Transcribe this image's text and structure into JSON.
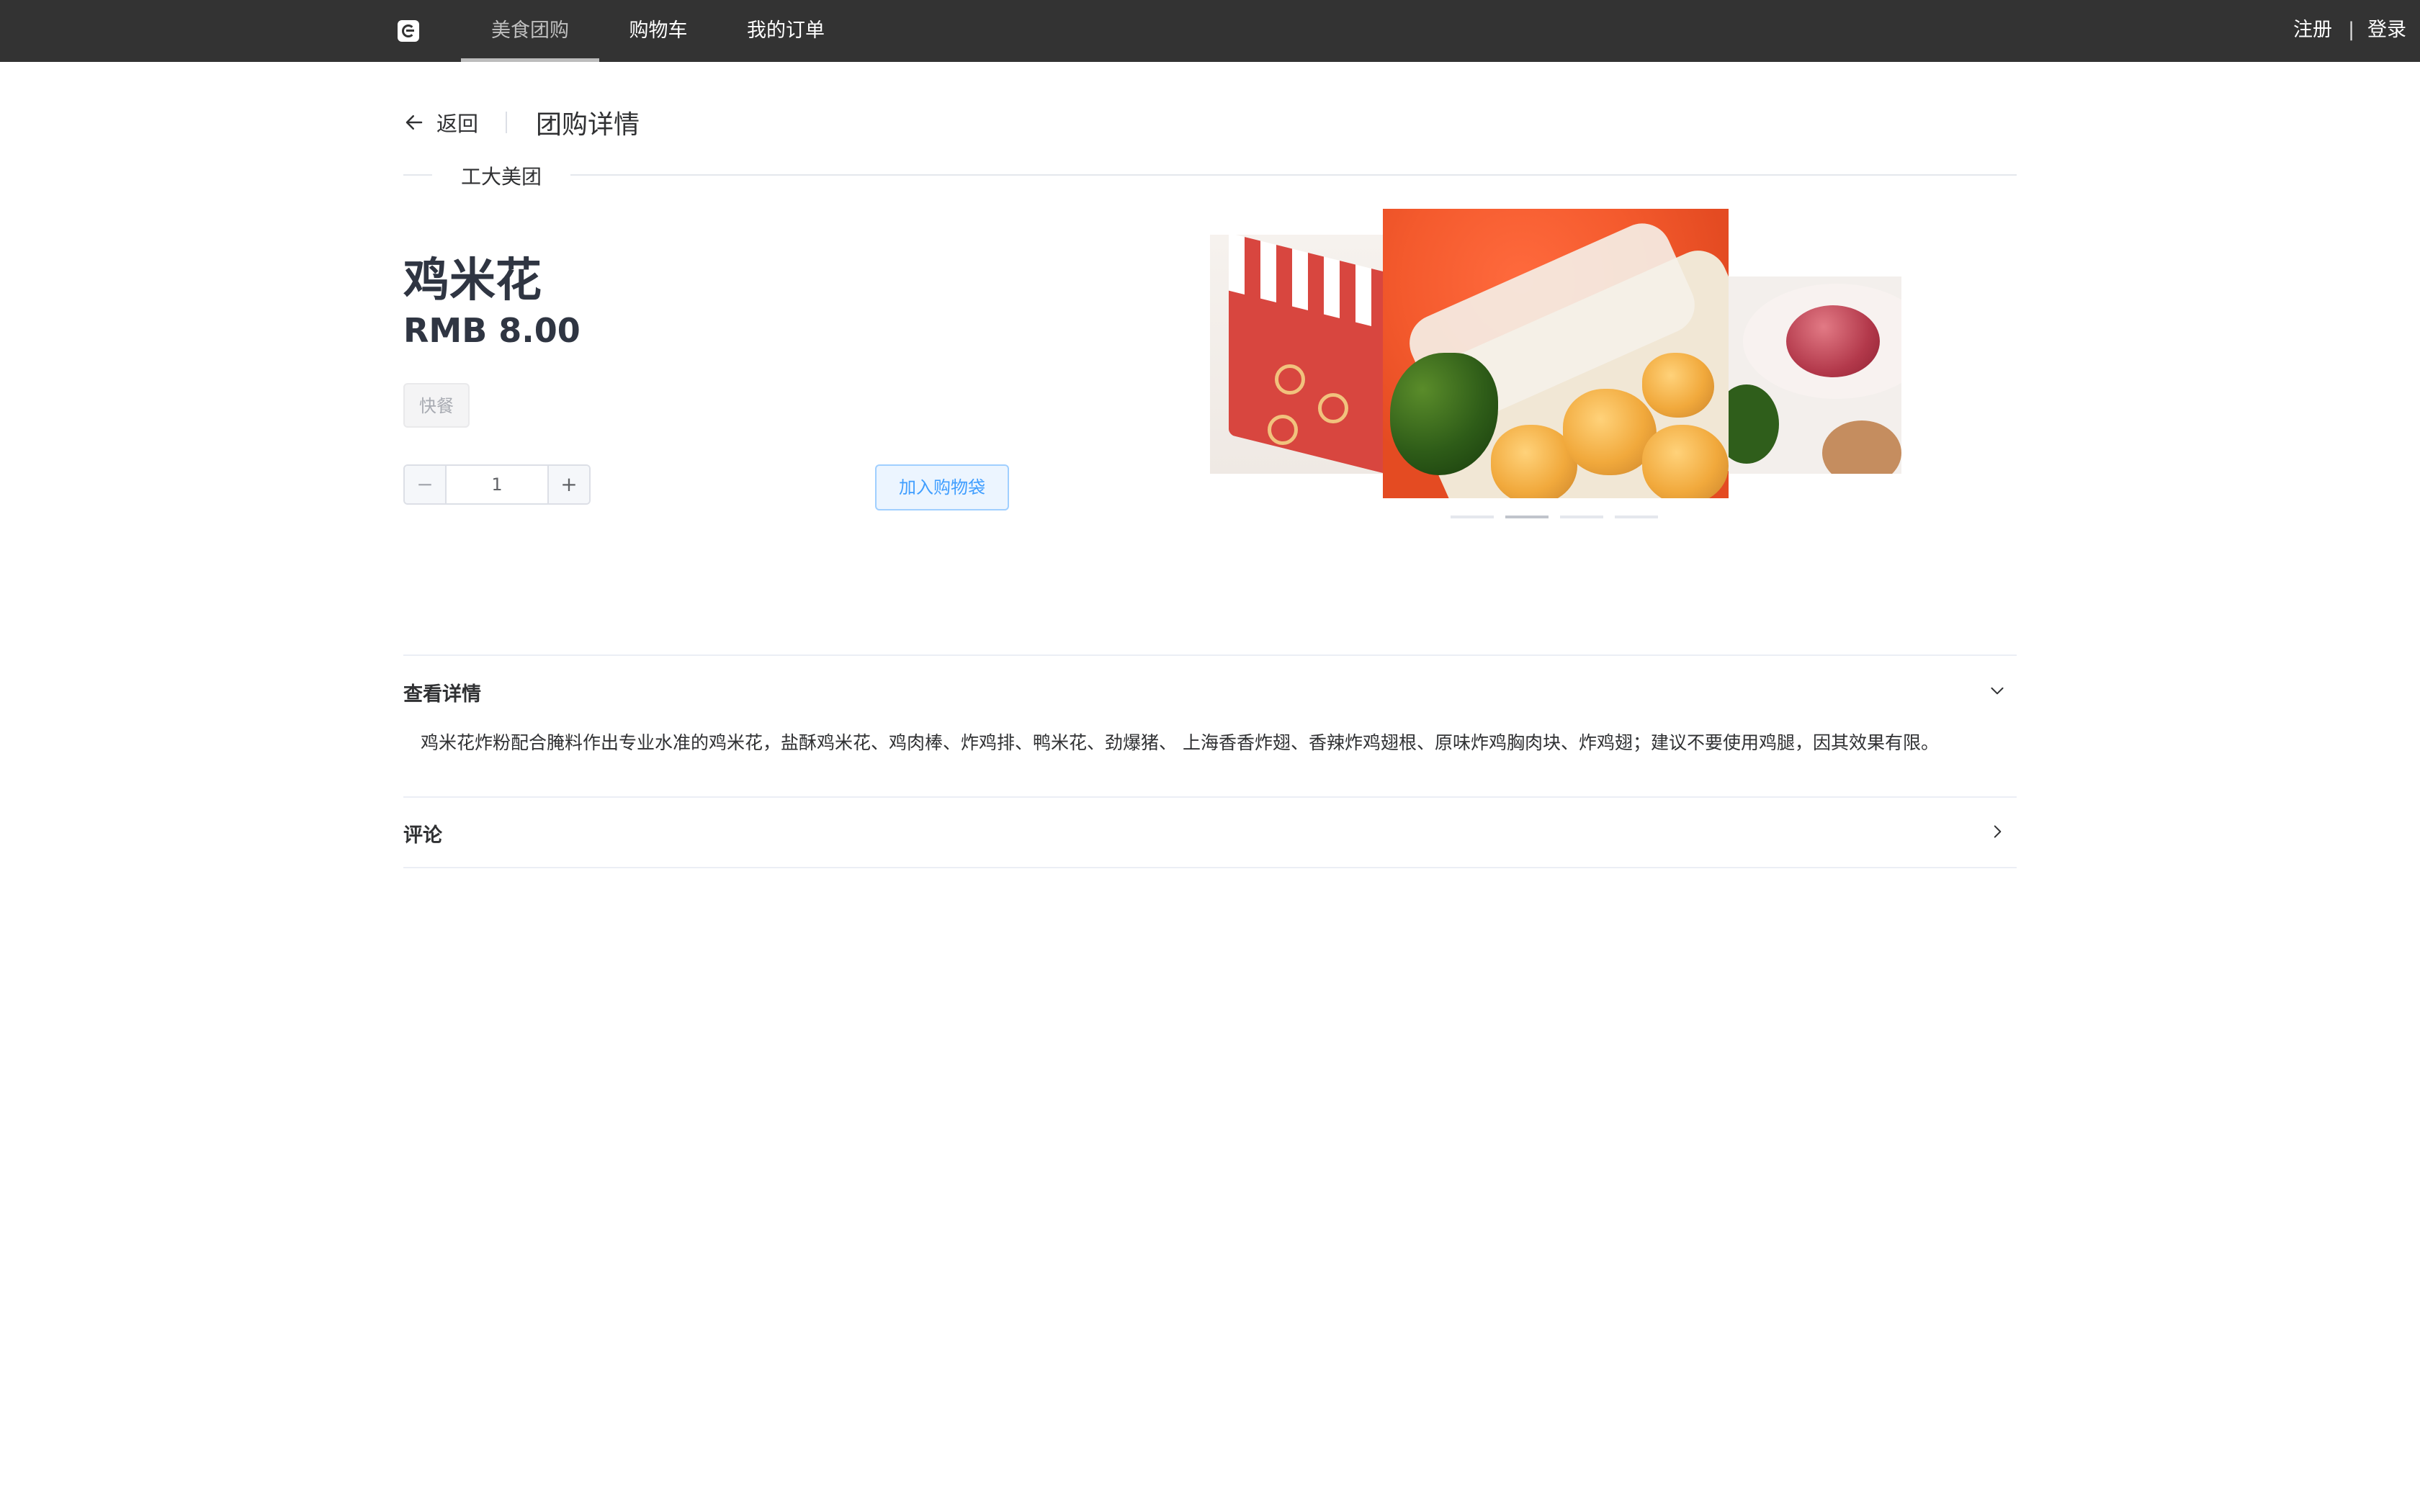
{
  "nav": {
    "items": [
      {
        "label": "美食团购",
        "active": true
      },
      {
        "label": "购物车",
        "active": false
      },
      {
        "label": "我的订单",
        "active": false
      }
    ],
    "register": "注册",
    "separator": "|",
    "login": "登录"
  },
  "header": {
    "back_label": "返回",
    "title": "团购详情"
  },
  "merchant": "工大美团",
  "product": {
    "name": "鸡米花",
    "price": "RMB 8.00",
    "tag": "快餐",
    "quantity": "1",
    "add_to_cart": "加入购物袋"
  },
  "carousel": {
    "slide_count": 4,
    "active_index": 1
  },
  "sections": {
    "details_title": "查看详情",
    "details_text": "鸡米花炸粉配合腌料作出专业水准的鸡米花，盐酥鸡米花、鸡肉棒、炸鸡排、鸭米花、劲爆猪、 上海香香炸翅、香辣炸鸡翅根、原味炸鸡胸肉块、炸鸡翅；建议不要使用鸡腿，因其效果有限。",
    "comments_title": "评论"
  },
  "colors": {
    "topbar": "#333333",
    "primary": "#409eff",
    "text": "#303133"
  }
}
